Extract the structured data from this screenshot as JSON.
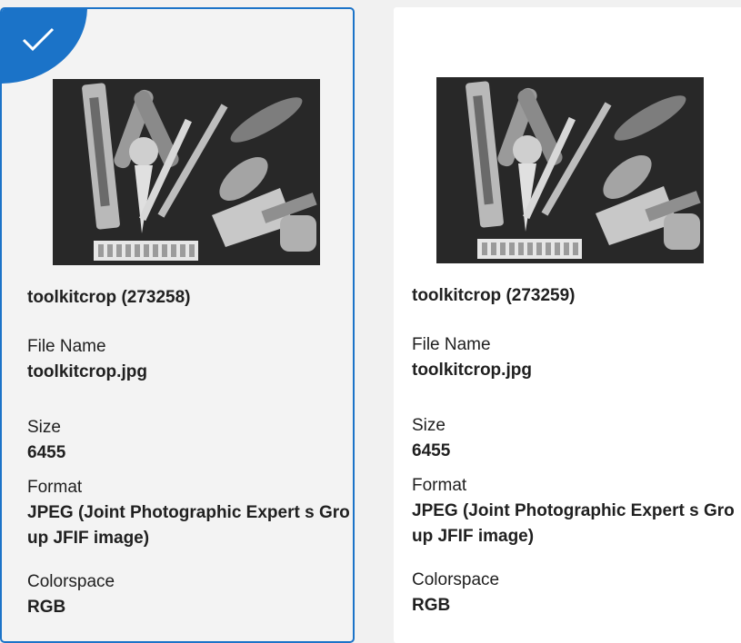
{
  "cards": [
    {
      "selected": true,
      "title": "toolkitcrop (273258)",
      "fields": {
        "file_label": "File Name",
        "file_value": "toolkitcrop.jpg",
        "size_label": "Size",
        "size_value": "6455",
        "format_label": "Format",
        "format_value": "JPEG (Joint Photographic Expert s Group JFIF image)",
        "color_label": "Colorspace",
        "color_value": "RGB"
      }
    },
    {
      "selected": false,
      "title": "toolkitcrop (273259)",
      "fields": {
        "file_label": "File Name",
        "file_value": "toolkitcrop.jpg",
        "size_label": "Size",
        "size_value": "6455",
        "format_label": "Format",
        "format_value": "JPEG (Joint Photographic Expert s Group JFIF image)",
        "color_label": "Colorspace",
        "color_value": "RGB"
      }
    }
  ],
  "icons": {
    "selected_badge": "checkmark-icon"
  },
  "colors": {
    "accent": "#1b73c8",
    "card_bg": "#f3f3f3",
    "page_bg": "#f1f1f1"
  }
}
